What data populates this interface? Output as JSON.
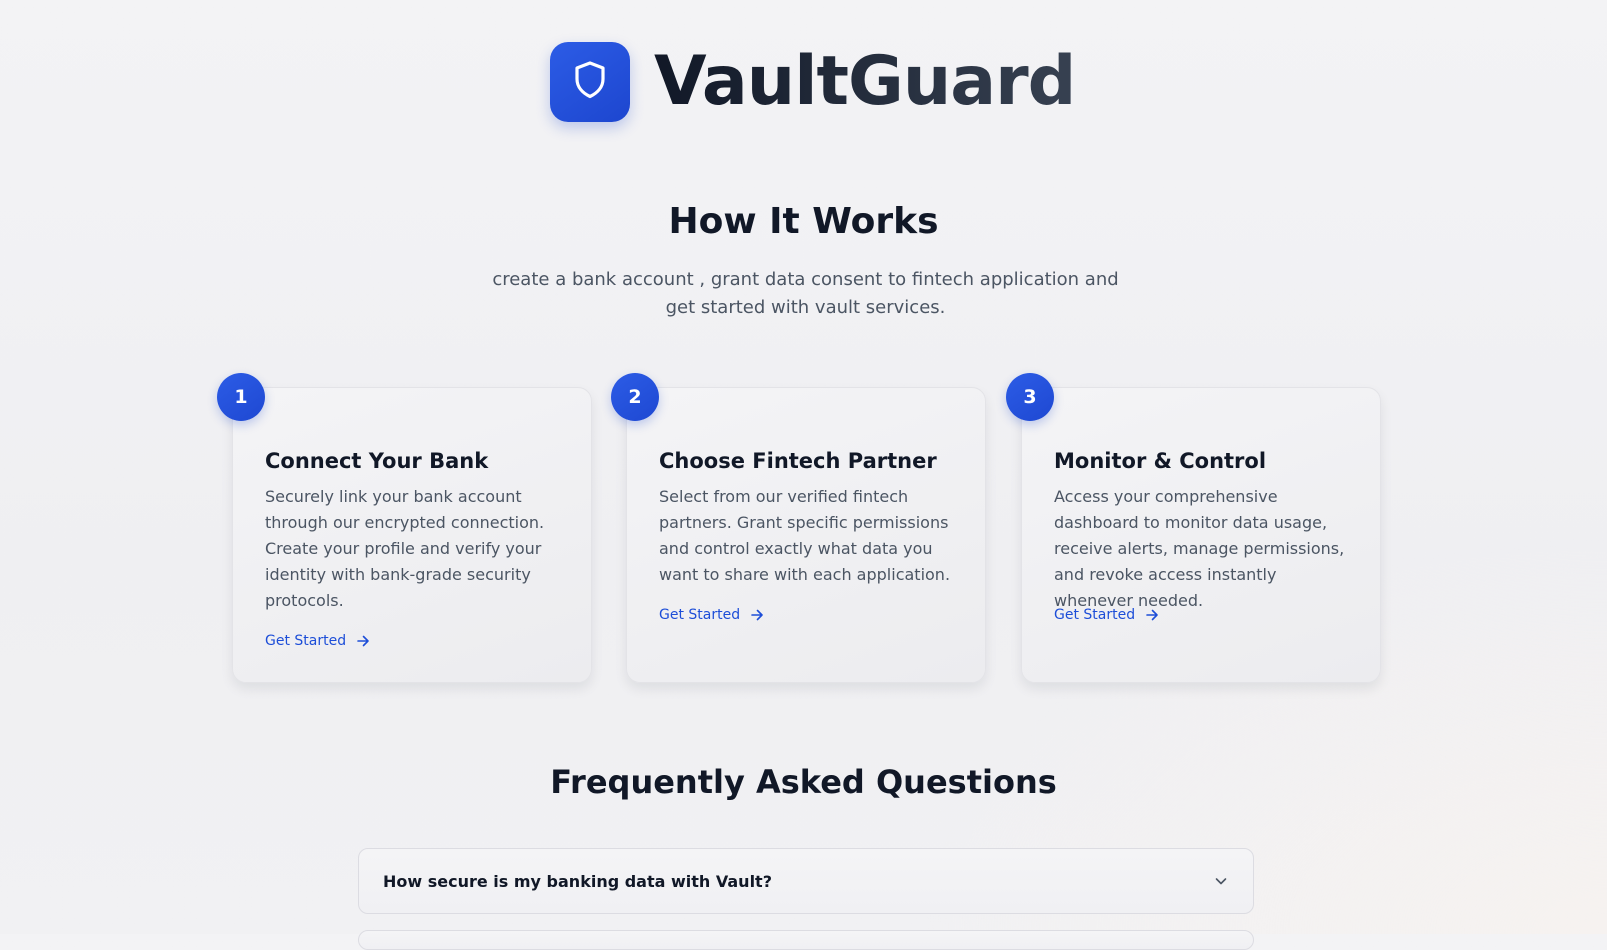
{
  "brand": {
    "name": "VaultGuard",
    "logo_icon": "shield-icon",
    "logo_color": "#2454dd"
  },
  "how_it_works": {
    "title": "How It Works",
    "description": "create a bank account , grant data consent to fintech application and get started with vault services.",
    "steps": [
      {
        "number": "1",
        "title": "Connect Your Bank",
        "description": "Securely link your bank account through our encrypted connection. Create your profile and verify your identity with bank-grade security protocols.",
        "link_label": "Get Started",
        "link_icon": "arrow-right-icon"
      },
      {
        "number": "2",
        "title": "Choose Fintech Partner",
        "description": "Select from our verified fintech partners. Grant specific permissions and control exactly what data you want to share with each application.",
        "link_label": "Get Started",
        "link_icon": "arrow-right-icon"
      },
      {
        "number": "3",
        "title": "Monitor & Control",
        "description": "Access your comprehensive dashboard to monitor data usage, receive alerts, manage permissions, and revoke access instantly whenever needed.",
        "link_label": "Get Started",
        "link_icon": "arrow-right-icon"
      }
    ]
  },
  "faq": {
    "title": "Frequently Asked Questions",
    "items": [
      {
        "question": "How secure is my banking data with Vault?",
        "icon": "chevron-down-icon"
      }
    ]
  },
  "colors": {
    "accent": "#1d4ed8",
    "heading": "#111827",
    "body_text": "#4b5563",
    "background": "#f1f1f3"
  }
}
